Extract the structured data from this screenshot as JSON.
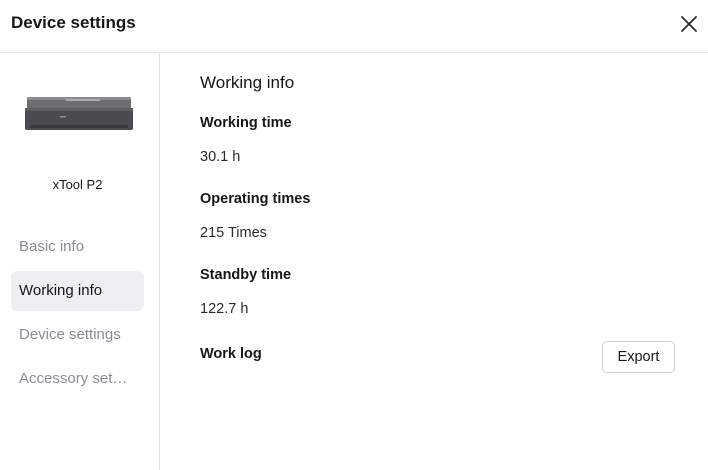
{
  "header": {
    "title": "Device settings",
    "close_icon": "close-icon"
  },
  "sidebar": {
    "device_name": "xTool P2",
    "device_icon": "laser-engraver-image",
    "items": [
      {
        "label": "Basic info",
        "active": false
      },
      {
        "label": "Working info",
        "active": true
      },
      {
        "label": "Device settings",
        "active": false
      },
      {
        "label": "Accessory settings",
        "active": false
      }
    ]
  },
  "main": {
    "title": "Working info",
    "working_time": {
      "label": "Working time",
      "value": "30.1 h"
    },
    "operating_times": {
      "label": "Operating times",
      "value": "215 Times"
    },
    "standby_time": {
      "label": "Standby time",
      "value": "122.7 h"
    },
    "work_log": {
      "label": "Work log",
      "button": "Export"
    }
  }
}
